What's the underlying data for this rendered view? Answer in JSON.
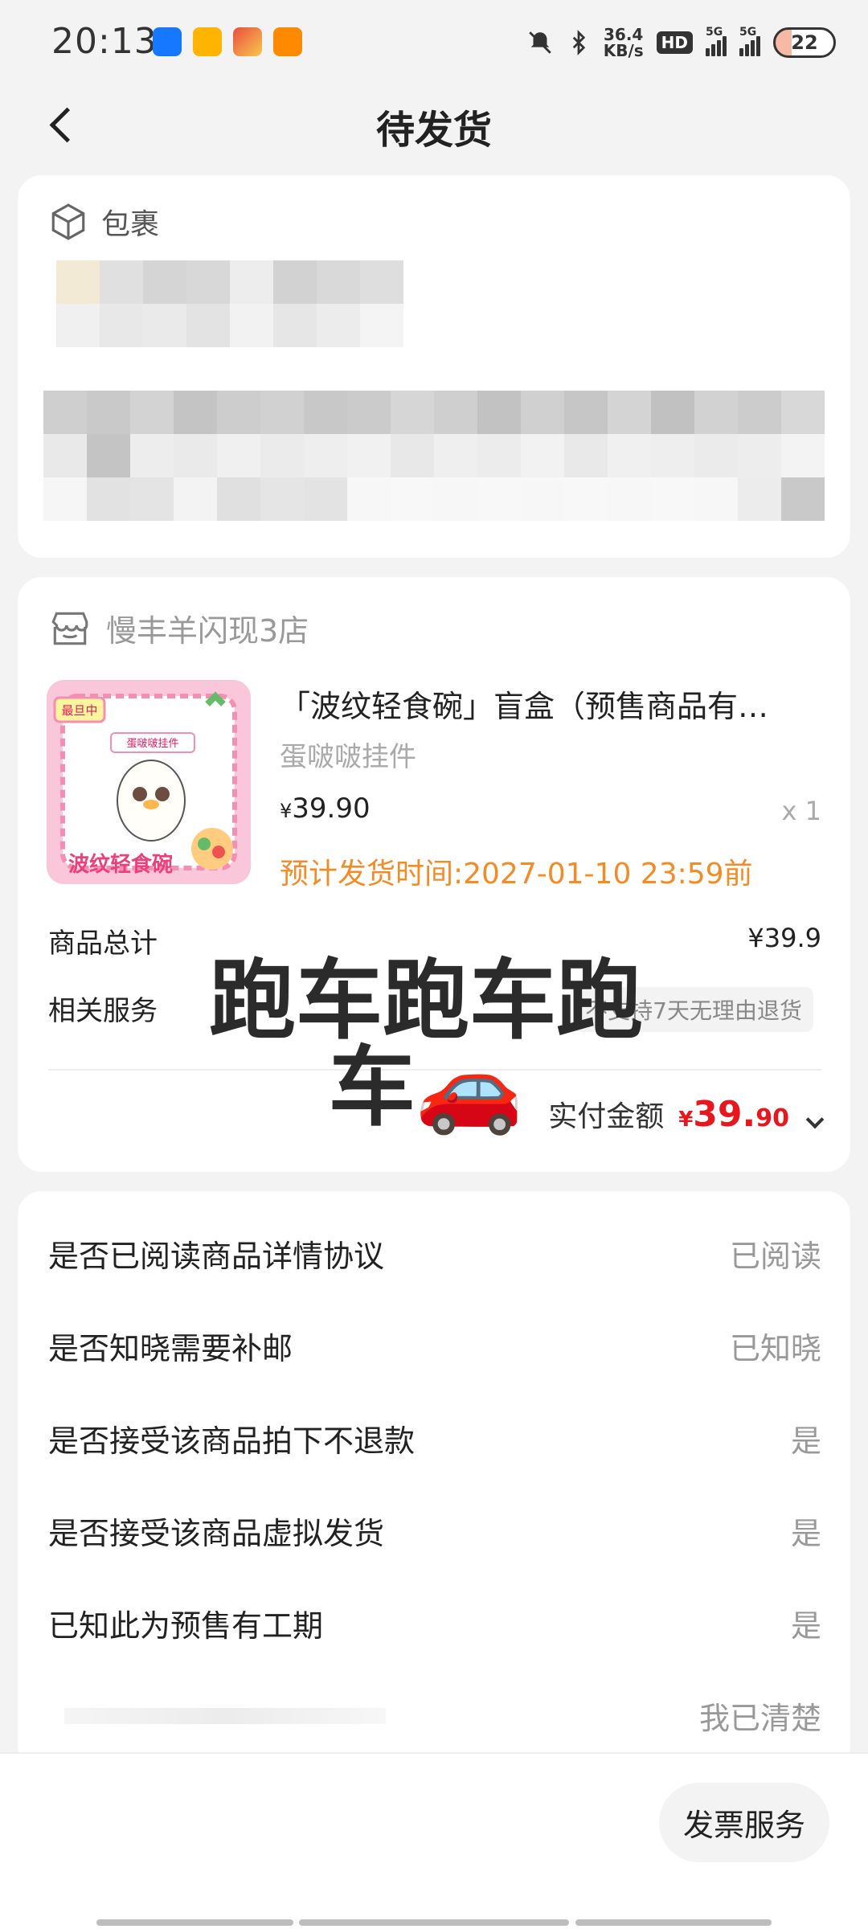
{
  "status": {
    "time": "20:13",
    "net_speed_value": "36.4",
    "net_speed_unit": "KB/s",
    "hd_label": "HD",
    "signal1_label": "5G",
    "signal2_label": "5G",
    "battery": "22"
  },
  "nav": {
    "title": "待发货"
  },
  "package": {
    "label": "包裹"
  },
  "shop": {
    "name": "慢丰羊闪现3店",
    "product": {
      "title": "「波纹轻食碗」盲盒（预售商品有…",
      "spec": "蛋啵啵挂件",
      "price_symbol": "¥",
      "price": "39.90",
      "quantity": "x 1",
      "ship_time": "预计发货时间:2027-01-10 23:59前",
      "image_badge": "最旦中",
      "image_tag": "蛋啵啵挂件",
      "image_brand": "波纹轻食碗"
    },
    "total_label": "商品总计",
    "total_value": "¥39.9",
    "service_label": "相关服务",
    "service_tag": "不支持7天无理由退货",
    "paid_label": "实付金额",
    "paid_currency": "¥",
    "paid_int": "39.",
    "paid_dec": "90"
  },
  "overlay": {
    "line1": "跑车跑车跑",
    "line2": "车🚗"
  },
  "confirmations": [
    {
      "label": "是否已阅读商品详情协议",
      "value": "已阅读"
    },
    {
      "label": "是否知晓需要补邮",
      "value": "已知晓"
    },
    {
      "label": "是否接受该商品拍下不退款",
      "value": "是"
    },
    {
      "label": "是否接受该商品虚拟发货",
      "value": "是"
    },
    {
      "label": "已知此为预售有工期",
      "value": "是"
    },
    {
      "label": "",
      "value": "我已清楚"
    }
  ],
  "bottom": {
    "invoice_button": "发票服务"
  },
  "colors": {
    "accent": "#f28c28",
    "price_red": "#e8171e",
    "background": "#f3f3f3"
  }
}
